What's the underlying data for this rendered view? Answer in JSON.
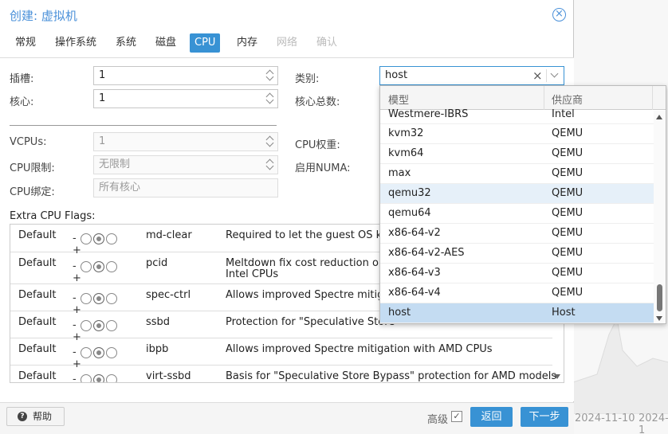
{
  "window": {
    "title": "创建: 虚拟机"
  },
  "tabs": [
    {
      "label": "常规",
      "state": "normal"
    },
    {
      "label": "操作系统",
      "state": "normal"
    },
    {
      "label": "系统",
      "state": "normal"
    },
    {
      "label": "磁盘",
      "state": "normal"
    },
    {
      "label": "CPU",
      "state": "active"
    },
    {
      "label": "内存",
      "state": "normal"
    },
    {
      "label": "网络",
      "state": "disabled"
    },
    {
      "label": "确认",
      "state": "disabled"
    }
  ],
  "form": {
    "sockets": {
      "label": "插槽:",
      "value": "1"
    },
    "cores": {
      "label": "核心:",
      "value": "1"
    },
    "type": {
      "label": "类别:",
      "value": "host"
    },
    "total_cores": {
      "label": "核心总数:"
    },
    "vcpus": {
      "label": "VCPUs:",
      "value": "1"
    },
    "cpu_weight": {
      "label": "CPU权重:"
    },
    "cpu_limit": {
      "label": "CPU限制:",
      "value": "无限制"
    },
    "numa": {
      "label": "启用NUMA:"
    },
    "cpu_affinity": {
      "label": "CPU绑定:",
      "placeholder": "所有核心"
    }
  },
  "flags": {
    "title": "Extra CPU Flags:",
    "rows": [
      {
        "state": "Default",
        "name": "md-clear",
        "desc": "Required to let the guest OS know",
        "desc2": ""
      },
      {
        "state": "Default",
        "name": "pcid",
        "desc": "Meltdown fix cost reduction on W",
        "desc2": "Intel CPUs"
      },
      {
        "state": "Default",
        "name": "spec-ctrl",
        "desc": "Allows improved Spectre mitigatio",
        "desc2": ""
      },
      {
        "state": "Default",
        "name": "ssbd",
        "desc": "Protection for \"Speculative Store",
        "desc2": ""
      },
      {
        "state": "Default",
        "name": "ibpb",
        "desc": "Allows improved Spectre mitigation with AMD CPUs",
        "desc2": ""
      },
      {
        "state": "Default",
        "name": "virt-ssbd",
        "desc": "Basis for \"Speculative Store Bypass\" protection for AMD models",
        "desc2": ""
      }
    ]
  },
  "dropdown": {
    "headers": {
      "model": "模型",
      "vendor": "供应商"
    },
    "rows": [
      {
        "model": "Westmere-IBRS",
        "vendor": "Intel"
      },
      {
        "model": "kvm32",
        "vendor": "QEMU"
      },
      {
        "model": "kvm64",
        "vendor": "QEMU"
      },
      {
        "model": "max",
        "vendor": "QEMU"
      },
      {
        "model": "qemu32",
        "vendor": "QEMU"
      },
      {
        "model": "qemu64",
        "vendor": "QEMU"
      },
      {
        "model": "x86-64-v2",
        "vendor": "QEMU"
      },
      {
        "model": "x86-64-v2-AES",
        "vendor": "QEMU"
      },
      {
        "model": "x86-64-v3",
        "vendor": "QEMU"
      },
      {
        "model": "x86-64-v4",
        "vendor": "QEMU"
      },
      {
        "model": "host",
        "vendor": "Host"
      }
    ]
  },
  "footer": {
    "help": "帮助",
    "advanced": "高级",
    "advanced_checked": "✓",
    "back": "返回",
    "next": "下一步"
  },
  "background": {
    "date1": "2024-11-10",
    "date2": "2024-1"
  },
  "colors": {
    "accent": "#3892d4",
    "title": "#4a90d9"
  }
}
